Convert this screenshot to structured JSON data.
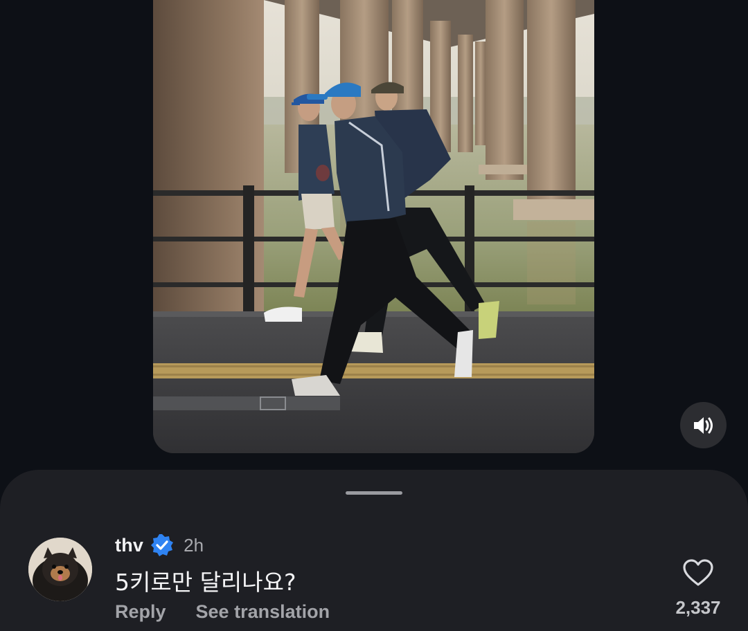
{
  "video": {
    "description_icon": "video-frame",
    "sound_icon": "speaker-volume-icon"
  },
  "comments_sheet": {
    "comment": {
      "username": "thv",
      "verified": true,
      "time": "2h",
      "text": "5키로만 달리나요?",
      "reply_label": "Reply",
      "translate_label": "See translation",
      "like_count": "2,337"
    }
  },
  "colors": {
    "background": "#0d1016",
    "sheet": "#1e1f24",
    "verified_badge": "#2f83f2",
    "muted_text": "#a3a4a9"
  }
}
